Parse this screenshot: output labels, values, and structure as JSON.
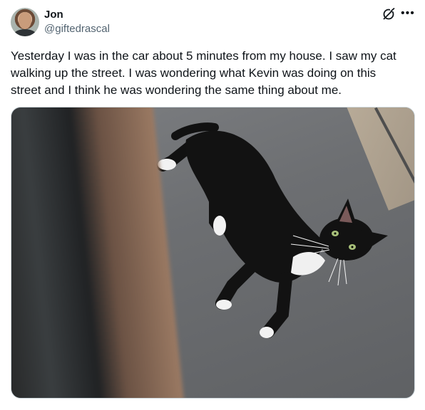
{
  "author": {
    "name": "Jon",
    "handle": "@giftedrascal"
  },
  "tweet": {
    "text": "Yesterday I was in the car about 5 minutes from my house. I saw my cat\nwalking up the street. I was wondering what Kevin was doing on this\nstreet and I think he was wondering the same thing about me."
  },
  "icons": {
    "grok": "grok-icon",
    "more": "more-icon"
  },
  "colors": {
    "text": "#0f1419",
    "secondary": "#536471"
  }
}
